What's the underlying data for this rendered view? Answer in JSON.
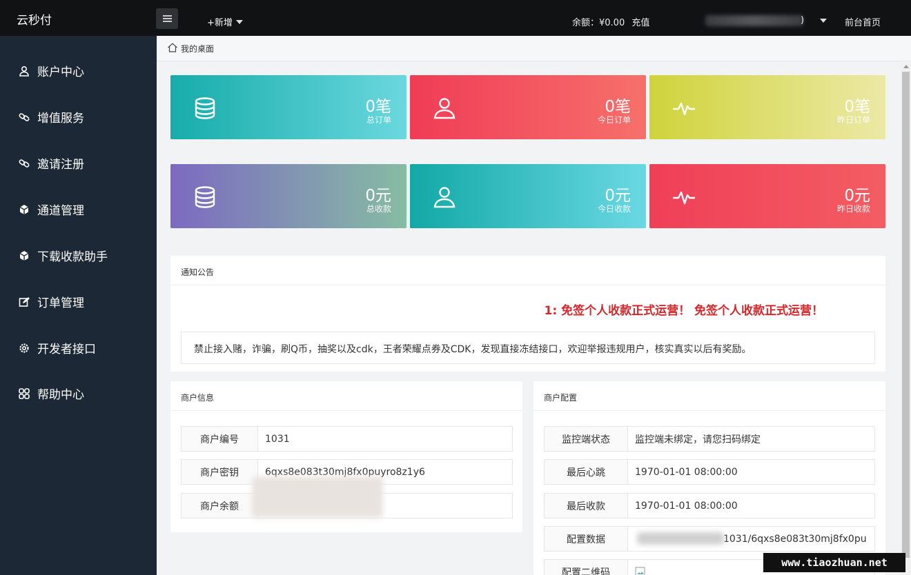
{
  "topbar": {
    "logo": "云秒付",
    "add_new": "+新增",
    "balance": "余额：¥0.00",
    "recharge": "充值",
    "user_tail": ")",
    "home_link": "前台首页"
  },
  "sidebar": {
    "items": [
      {
        "label": "账户中心",
        "icon": "user-icon"
      },
      {
        "label": "增值服务",
        "icon": "link-icon"
      },
      {
        "label": "邀请注册",
        "icon": "link-icon"
      },
      {
        "label": "通道管理",
        "icon": "cube-icon"
      },
      {
        "label": "下载收款助手",
        "icon": "cube-icon"
      },
      {
        "label": "订单管理",
        "icon": "edit-icon"
      },
      {
        "label": "开发者接口",
        "icon": "gear-icon"
      },
      {
        "label": "帮助中心",
        "icon": "grid-icon"
      }
    ]
  },
  "breadcrumb": {
    "label": "我的桌面",
    "icon": "home-icon"
  },
  "stats": [
    {
      "value": "0笔",
      "label": "总订单",
      "icon": "database-icon"
    },
    {
      "value": "0笔",
      "label": "今日订单",
      "icon": "user-icon"
    },
    {
      "value": "0笔",
      "label": "昨日订单",
      "icon": "pulse-icon"
    },
    {
      "value": "0元",
      "label": "总收款",
      "icon": "database-icon"
    },
    {
      "value": "0元",
      "label": "今日收款",
      "icon": "user-icon"
    },
    {
      "value": "0元",
      "label": "昨日收款",
      "icon": "pulse-icon"
    }
  ],
  "colors": {
    "card1": "#1fb5b3",
    "card2": "#f2485b",
    "card3": "#d6d84a",
    "card4": "#7b6fc1",
    "card5": "#17acaa",
    "card6": "#f0485a"
  },
  "notice": {
    "title": "通知公告",
    "headline": "1: 免签个人收款正式运营！ 免签个人收款正式运营！",
    "body": "禁止接入赌，诈骗，刷Q币，抽奖以及cdk，王者荣耀点券及CDK，发现直接冻结接口，欢迎举报违规用户，核实真实以后有奖励。"
  },
  "merchant_info": {
    "title": "商户信息",
    "rows": [
      {
        "label": "商户编号",
        "value": "1031"
      },
      {
        "label": "商户密钥",
        "value": "6qxs8e083t30mj8fx0puyro8z1y6"
      },
      {
        "label": "商户余额",
        "value": ""
      }
    ]
  },
  "merchant_config": {
    "title": "商户配置",
    "rows": [
      {
        "label": "监控端状态",
        "value": "监控端未绑定，请您扫码绑定"
      },
      {
        "label": "最后心跳",
        "value": "1970-01-01 08:00:00"
      },
      {
        "label": "最后收款",
        "value": "1970-01-01 08:00:00"
      },
      {
        "label": "配置数据",
        "value": "1031/6qxs8e083t30mj8fx0pu"
      },
      {
        "label": "配置二维码",
        "value": ""
      }
    ]
  },
  "watermark": "www.tiaozhuan.net"
}
